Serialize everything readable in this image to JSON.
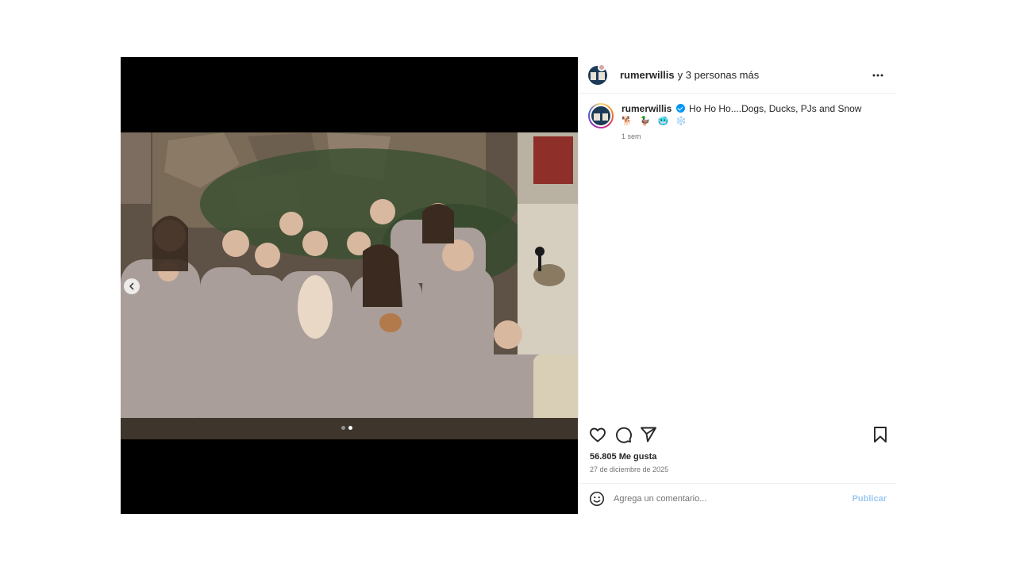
{
  "post": {
    "header": {
      "username": "rumerwillis",
      "coauthors_text": "y 3 personas más",
      "more_icon": "more-horizontal-icon"
    },
    "media": {
      "description_icon": "family-photo",
      "carousel": {
        "current": 2,
        "total": 2
      },
      "prev_icon": "chevron-left-icon"
    },
    "caption": {
      "username": "rumerwillis",
      "verified_icon": "verified-badge-icon",
      "text": "Ho Ho Ho....Dogs, Ducks, PJs and Snow",
      "emojis": "🐕 🦆 🥶 ❄️",
      "time_ago": "1 sem"
    },
    "actions": {
      "like_icon": "heart-icon",
      "comment_icon": "comment-icon",
      "share_icon": "send-icon",
      "save_icon": "bookmark-icon"
    },
    "likes_text": "56.805 Me gusta",
    "date_text": "27 de diciembre de 2025",
    "comment_box": {
      "emoji_icon": "emoji-icon",
      "placeholder": "Agrega un comentario...",
      "publish_label": "Publicar",
      "publish_color": "#9ec9f5"
    }
  }
}
